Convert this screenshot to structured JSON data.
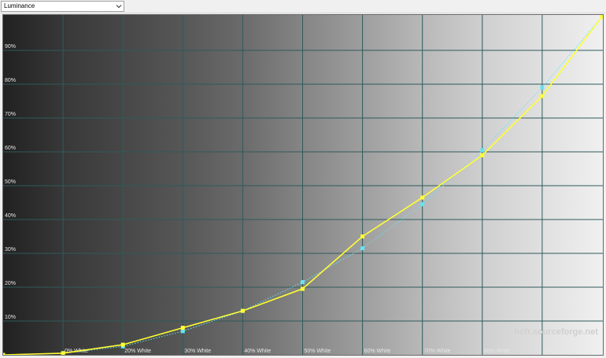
{
  "selector": {
    "value": "Luminance",
    "icon": "chevron-down-icon"
  },
  "watermark": "hcfr.sourceforge.net",
  "colors": {
    "measured": "#ffff33",
    "reference": "#66e4f0",
    "grid": "#2f5a5a",
    "label": "#e6e6e6"
  },
  "chart_data": {
    "type": "line",
    "title": "",
    "xlabel": "",
    "ylabel": "",
    "xlim": [
      0,
      100
    ],
    "ylim": [
      0,
      100
    ],
    "x": [
      0,
      10,
      20,
      30,
      40,
      50,
      60,
      70,
      80,
      90,
      100
    ],
    "x_tick_labels": [
      "0% White",
      "20% White",
      "30% White",
      "40% White",
      "50% White",
      "60% White",
      "70% White",
      "80% White",
      "90% White"
    ],
    "x_tick_positions": [
      10,
      20,
      30,
      40,
      50,
      60,
      70,
      80,
      90
    ],
    "y_tick_labels": [
      "10%",
      "20%",
      "30%",
      "40%",
      "50%",
      "60%",
      "70%",
      "80%",
      "90%"
    ],
    "y_tick_positions": [
      10,
      20,
      30,
      40,
      50,
      60,
      70,
      80,
      90
    ],
    "background_gray_steps": [
      0.13,
      0.22,
      0.28,
      0.34,
      0.42,
      0.52,
      0.62,
      0.72,
      0.81,
      0.88,
      0.94
    ],
    "grid": true,
    "series": [
      {
        "role": "measured",
        "style": "solid",
        "marker": "square",
        "values": [
          0,
          0.5,
          3,
          8,
          13,
          19.5,
          35,
          46.5,
          59,
          76.5,
          100
        ]
      },
      {
        "role": "reference",
        "style": "dotted",
        "marker": "square",
        "values": [
          0,
          0.5,
          2.5,
          7,
          13,
          21.5,
          31.5,
          44.5,
          60.5,
          79,
          100
        ]
      }
    ]
  }
}
